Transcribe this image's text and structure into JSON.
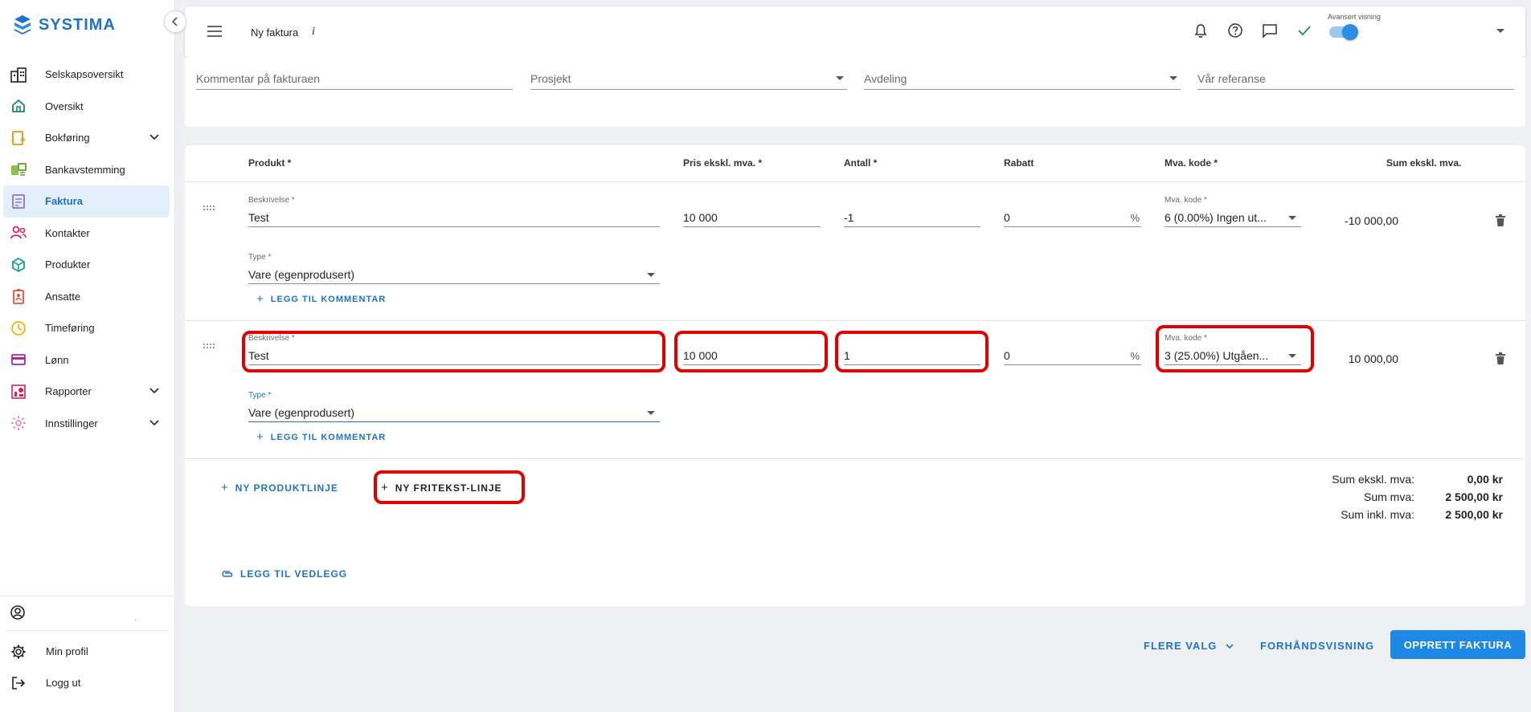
{
  "brand": {
    "name": "SYSTIMA",
    "color": "#1e73c9"
  },
  "sidebar": {
    "items": [
      {
        "label": "Selskapsoversikt",
        "icon": "building-icon"
      },
      {
        "label": "Oversikt",
        "icon": "home-icon"
      },
      {
        "label": "Bokføring",
        "icon": "bookkeeping-icon",
        "expandable": true
      },
      {
        "label": "Bankavstemming",
        "icon": "bank-reconcile-icon"
      },
      {
        "label": "Faktura",
        "icon": "invoice-icon",
        "active": true
      },
      {
        "label": "Kontakter",
        "icon": "contacts-icon"
      },
      {
        "label": "Produkter",
        "icon": "box-icon"
      },
      {
        "label": "Ansatte",
        "icon": "employee-badge-icon"
      },
      {
        "label": "Timeføring",
        "icon": "clock-icon"
      },
      {
        "label": "Lønn",
        "icon": "card-icon"
      },
      {
        "label": "Rapporter",
        "icon": "reports-icon",
        "expandable": true
      },
      {
        "label": "Innstillinger",
        "icon": "settings-icon",
        "expandable": true
      }
    ],
    "user_dot": ".",
    "bottom": [
      {
        "label": "Min profil",
        "icon": "gear-icon"
      },
      {
        "label": "Logg ut",
        "icon": "logout-icon"
      }
    ]
  },
  "header": {
    "title": "Ny faktura",
    "info_glyph": "i",
    "advanced_view_label": "Avansert visning",
    "advanced_view_on": true
  },
  "filters": {
    "comment_placeholder": "Kommentar på fakturaen",
    "project_placeholder": "Prosjekt",
    "department_placeholder": "Avdeling",
    "our_reference_placeholder": "Vår referanse"
  },
  "table": {
    "headers": {
      "product": "Produkt *",
      "price": "Pris ekskl. mva. *",
      "quantity": "Antall *",
      "discount": "Rabatt",
      "vat_code": "Mva. kode *",
      "sum": "Sum ekskl. mva."
    },
    "rows": [
      {
        "description_label": "Beskrivelse *",
        "description": "Test",
        "price": "10 000",
        "quantity": "-1",
        "discount": "0",
        "discount_unit": "%",
        "vat_label": "Mva. kode *",
        "vat": "6 (0.00%) Ingen ut...",
        "sum": "-10 000,00",
        "type_label": "Type *",
        "type": "Vare (egenprodusert)",
        "add_comment": "LEGG TIL KOMMENTAR"
      },
      {
        "description_label": "Beskrivelse *",
        "description": "Test",
        "price": "10 000",
        "quantity": "1",
        "discount": "0",
        "discount_unit": "%",
        "vat_label": "Mva. kode *",
        "vat": "3 (25.00%) Utgåen...",
        "sum": "10 000,00",
        "type_label": "Type *",
        "type": "Vare (egenprodusert)",
        "add_comment": "LEGG TIL KOMMENTAR"
      }
    ]
  },
  "line_actions": {
    "new_product_line": "NY PRODUKTLINJE",
    "new_freetext_line": "NY FRITEKST-LINJE",
    "add_attachment": "LEGG TIL VEDLEGG"
  },
  "totals": {
    "excl_label": "Sum ekskl. mva:",
    "excl_value": "0,00 kr",
    "vat_label": "Sum mva:",
    "vat_value": "2 500,00 kr",
    "incl_label": "Sum inkl. mva:",
    "incl_value": "2 500,00 kr"
  },
  "footer": {
    "more_options": "FLERE VALG",
    "preview": "FORHÅNDSVISNING",
    "create": "OPPRETT FAKTURA"
  },
  "colors": {
    "highlight": "#e00000",
    "primary": "#1e88e5",
    "active_bg": "#e3f0fb"
  }
}
